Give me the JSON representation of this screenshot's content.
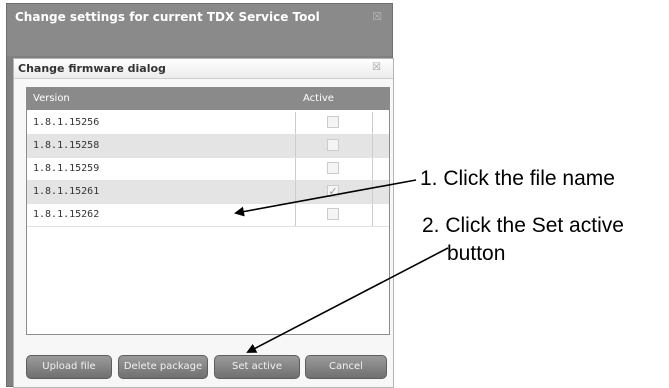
{
  "outer_window": {
    "title": "Change settings for current TDX Service Tool",
    "close_glyph": "☒"
  },
  "dialog": {
    "title": "Change firmware dialog",
    "close_glyph": "☒"
  },
  "table": {
    "headers": {
      "version": "Version",
      "active": "Active"
    },
    "rows": [
      {
        "version": "1.8.1.15256",
        "active": false
      },
      {
        "version": "1.8.1.15258",
        "active": false
      },
      {
        "version": "1.8.1.15259",
        "active": false
      },
      {
        "version": "1.8.1.15261",
        "active": true
      },
      {
        "version": "1.8.1.15262",
        "active": false
      }
    ]
  },
  "buttons": {
    "upload": "Upload file",
    "delete": "Delete package",
    "set_active": "Set active",
    "cancel": "Cancel"
  },
  "annotations": {
    "step1": "1. Click the file name",
    "step2_line1": "2. Click the Set active",
    "step2_line2": "button"
  },
  "colors": {
    "header_bg": "#8a8a8a",
    "button_bg": "#7a7a7a"
  },
  "icons": {
    "checkmark": "✓"
  }
}
